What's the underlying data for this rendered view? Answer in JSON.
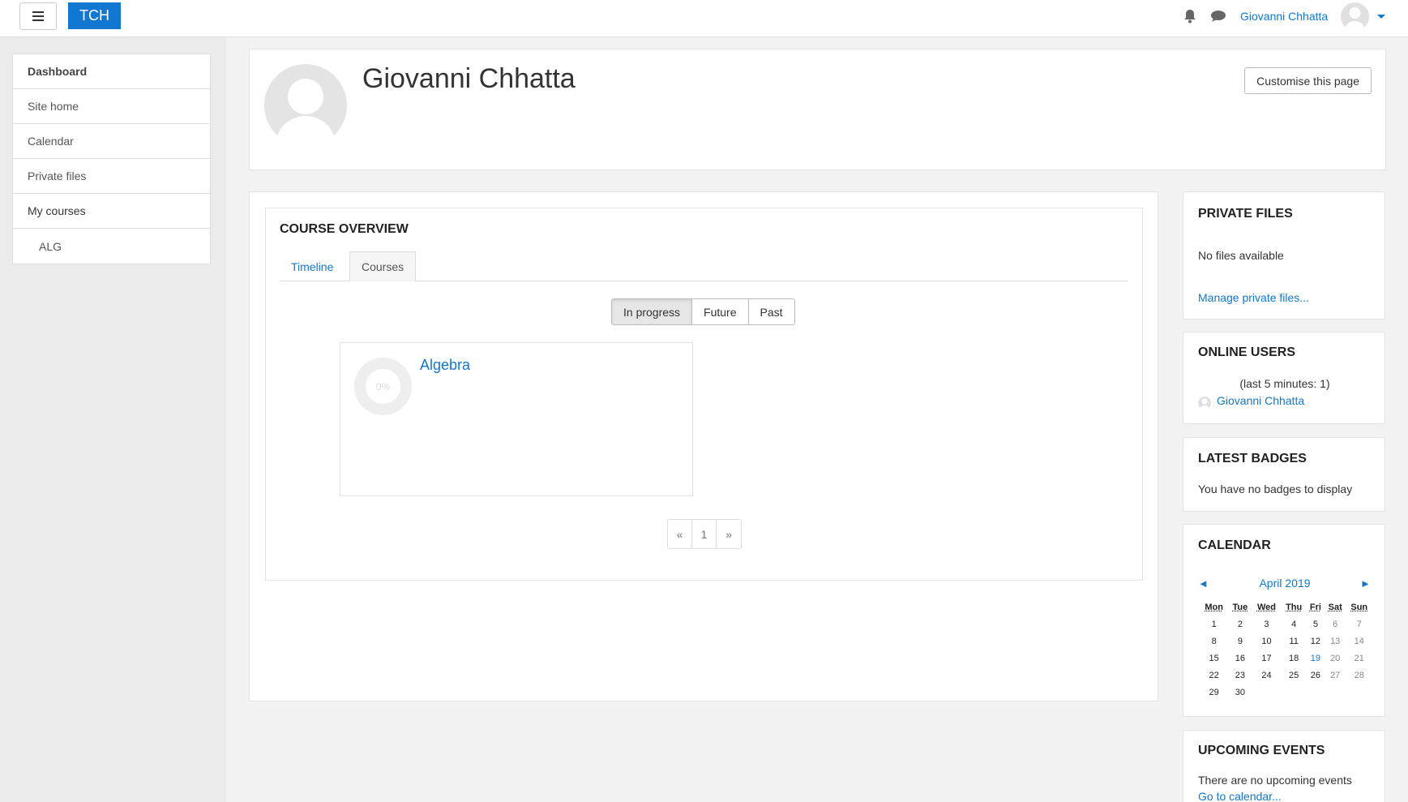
{
  "navbar": {
    "brand": "TCH",
    "username": "Giovanni Chhatta"
  },
  "drawer": {
    "items": [
      {
        "label": "Dashboard"
      },
      {
        "label": "Site home"
      },
      {
        "label": "Calendar"
      },
      {
        "label": "Private files"
      },
      {
        "label": "My courses"
      },
      {
        "label": "ALG"
      }
    ]
  },
  "header": {
    "title": "Giovanni Chhatta",
    "customise_label": "Customise this page"
  },
  "overview": {
    "title": "COURSE OVERVIEW",
    "tabs": [
      {
        "label": "Timeline"
      },
      {
        "label": "Courses"
      }
    ],
    "filters": [
      {
        "label": "In progress"
      },
      {
        "label": "Future"
      },
      {
        "label": "Past"
      }
    ],
    "course": {
      "name": "Algebra",
      "progress": "0%"
    },
    "pager": {
      "prev": "«",
      "page": "1",
      "next": "»"
    }
  },
  "private_files": {
    "title": "PRIVATE FILES",
    "empty": "No files available",
    "manage": "Manage private files..."
  },
  "online_users": {
    "title": "ONLINE USERS",
    "subtitle": "(last 5 minutes: 1)",
    "user": "Giovanni Chhatta"
  },
  "badges": {
    "title": "LATEST BADGES",
    "empty": "You have no badges to display"
  },
  "calendar": {
    "title": "CALENDAR",
    "prev": "◄",
    "month": "April 2019",
    "next": "►",
    "days": [
      "Mon",
      "Tue",
      "Wed",
      "Thu",
      "Fri",
      "Sat",
      "Sun"
    ],
    "weeks": [
      [
        "1",
        "2",
        "3",
        "4",
        "5",
        "6",
        "7"
      ],
      [
        "8",
        "9",
        "10",
        "11",
        "12",
        "13",
        "14"
      ],
      [
        "15",
        "16",
        "17",
        "18",
        "19",
        "20",
        "21"
      ],
      [
        "22",
        "23",
        "24",
        "25",
        "26",
        "27",
        "28"
      ],
      [
        "29",
        "30",
        "",
        "",
        "",
        "",
        ""
      ]
    ]
  },
  "upcoming": {
    "title": "UPCOMING EVENTS",
    "empty": "There are no upcoming events",
    "link": "Go to calendar..."
  },
  "colors": {
    "accent": "#1177d1",
    "background": "#f2f2f2"
  }
}
